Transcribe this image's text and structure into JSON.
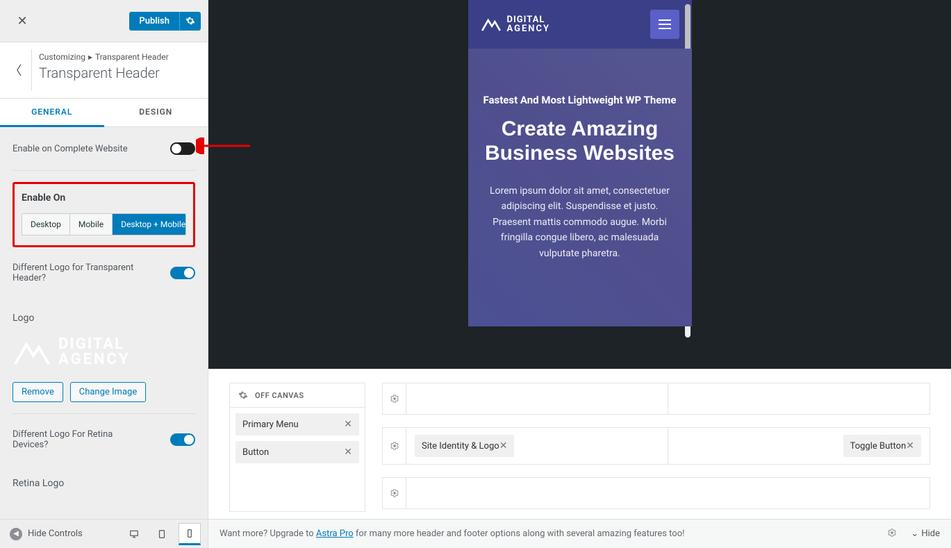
{
  "sidebar": {
    "publish_label": "Publish",
    "breadcrumb_root": "Customizing",
    "breadcrumb_leaf": "Transparent Header",
    "section_title": "Transparent Header",
    "tabs": {
      "general": "GENERAL",
      "design": "DESIGN"
    },
    "enable_complete_label": "Enable on Complete Website",
    "enable_on_title": "Enable On",
    "enable_on_options": [
      "Desktop",
      "Mobile",
      "Desktop + Mobile"
    ],
    "different_logo_label": "Different Logo for Transparent Header?",
    "logo_title": "Logo",
    "logo_text_1": "DIGITAL",
    "logo_text_2": "AGENCY",
    "remove_label": "Remove",
    "change_image_label": "Change Image",
    "retina_label": "Different Logo For Retina Devices?",
    "retina_logo_title": "Retina Logo",
    "hide_controls_label": "Hide Controls"
  },
  "preview": {
    "logo_text_1": "DIGITAL",
    "logo_text_2": "AGENCY",
    "hero_tag": "Fastest And Most Lightweight WP Theme",
    "hero_headline": "Create Amazing Business Websites",
    "hero_copy": "Lorem ipsum dolor sit amet, consectetuer adipiscing elit. Suspendisse et justo. Praesent mattis commodo augue. Morbi fringilla congue libero, ac malesuada vulputate pharetra."
  },
  "builder": {
    "off_canvas_title": "OFF CANVAS",
    "off_canvas_items": [
      "Primary Menu",
      "Button"
    ],
    "row2_left_item": "Site Identity & Logo",
    "row2_right_item": "Toggle Button"
  },
  "footer": {
    "upgrade_prefix": "Want more? Upgrade to ",
    "upgrade_link": "Astra Pro",
    "upgrade_suffix": " for many more header and footer options along with several amazing features too!",
    "hide_label": "Hide"
  }
}
